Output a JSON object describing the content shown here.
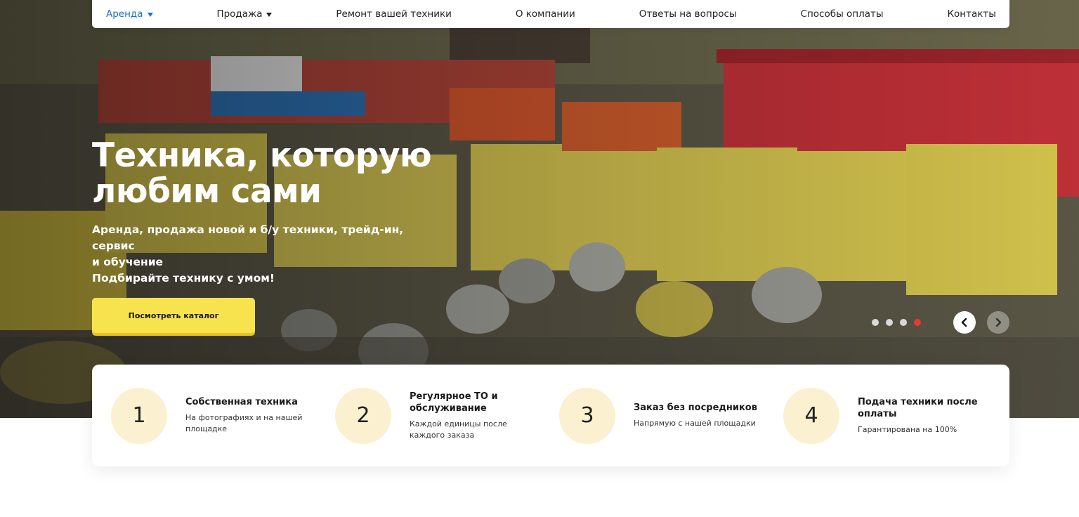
{
  "nav": {
    "items": [
      {
        "label": "Аренда",
        "dropdown": true,
        "active": true
      },
      {
        "label": "Продажа",
        "dropdown": true,
        "active": false
      },
      {
        "label": "Ремонт вашей техники",
        "dropdown": false,
        "active": false
      },
      {
        "label": "О компании",
        "dropdown": false,
        "active": false
      },
      {
        "label": "Ответы на вопросы",
        "dropdown": false,
        "active": false
      },
      {
        "label": "Способы оплаты",
        "dropdown": false,
        "active": false
      },
      {
        "label": "Контакты",
        "dropdown": false,
        "active": false
      }
    ]
  },
  "hero": {
    "title_line1": "Техника, которую",
    "title_line2": "любим сами",
    "subtitle_line1": "Аренда, продажа новой и б/у техники, трейд-ин, сервис",
    "subtitle_line2": "и обучение",
    "subtitle_line3": "Подбирайте технику с умом!",
    "cta_label": "Посмотреть каталог",
    "slides_count": 4,
    "active_slide": 4,
    "background": "photo of yellow construction heaters and trucks"
  },
  "features": [
    {
      "number": "1",
      "title": "Собственная техника",
      "desc": "На фотографиях и на нашей площадке"
    },
    {
      "number": "2",
      "title": "Регулярное ТО и обслуживание",
      "desc": "Каждой единицы после каждого заказа"
    },
    {
      "number": "3",
      "title": "Заказ без посредников",
      "desc": "Напрямую с нашей площадки"
    },
    {
      "number": "4",
      "title": "Подача техники после оплаты",
      "desc": "Гарантирована на 100%"
    }
  ],
  "colors": {
    "accent_blue": "#1a6fd6",
    "cta_yellow": "#f7e34e",
    "active_dot": "#e53935",
    "badge_bg": "#fbf0cf"
  },
  "icons": {
    "prev": "chevron-left-icon",
    "next": "chevron-right-icon",
    "dropdown": "caret-down-icon"
  }
}
